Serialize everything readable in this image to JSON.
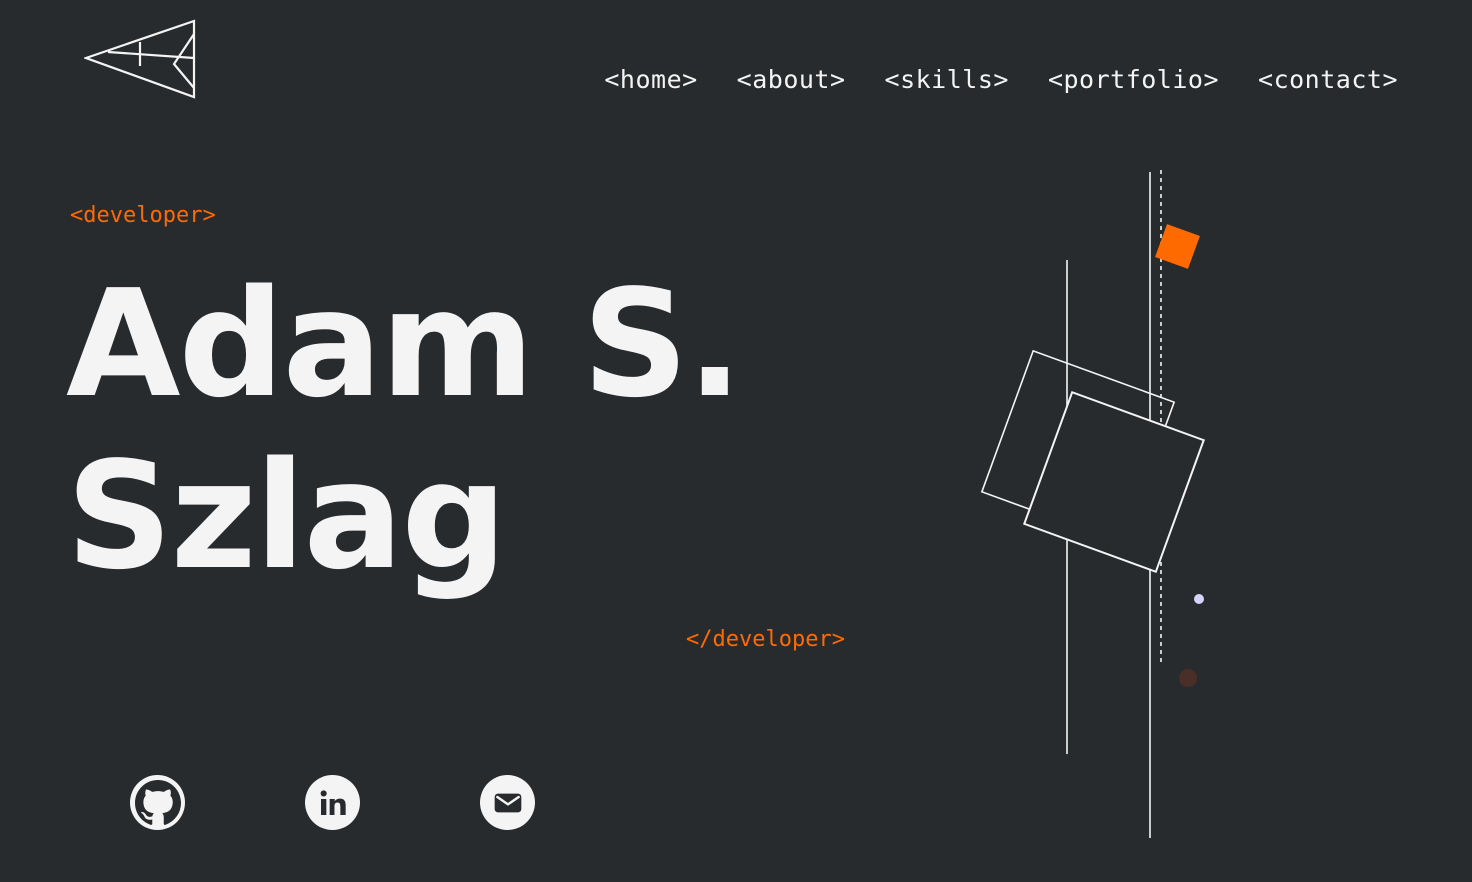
{
  "header": {
    "logo_icon": "paper-plane-logo-icon",
    "nav": [
      {
        "label": "<home>"
      },
      {
        "label": "<about>"
      },
      {
        "label": "<skills>"
      },
      {
        "label": "<portfolio>"
      },
      {
        "label": "<contact>"
      }
    ]
  },
  "hero": {
    "tag_open": "<developer>",
    "name_line1": "Adam S.",
    "name_line2": "Szlag",
    "tag_close": "</developer>"
  },
  "socials": [
    {
      "icon": "github-icon"
    },
    {
      "icon": "linkedin-icon"
    },
    {
      "icon": "email-icon"
    }
  ],
  "colors": {
    "background": "#282b2d",
    "text": "#f4f4f4",
    "accent": "#ff6a00",
    "dot": "#d6d3ff",
    "dark_dot": "#4a2e28"
  }
}
